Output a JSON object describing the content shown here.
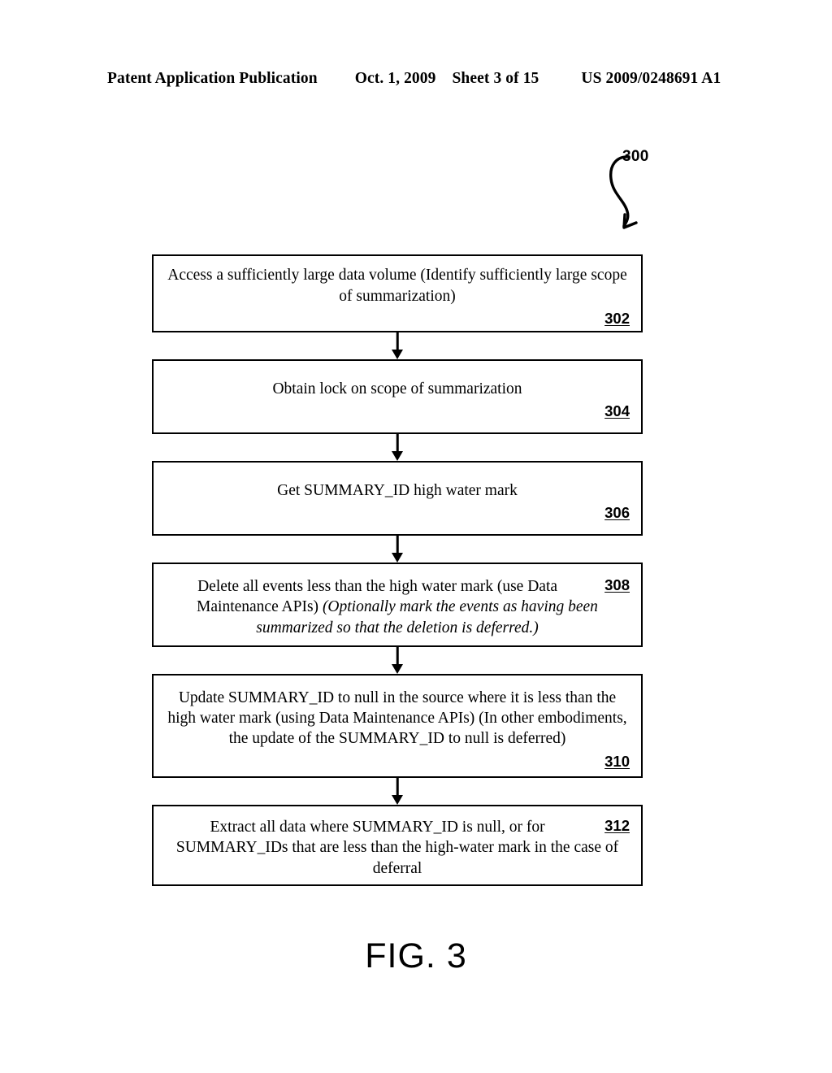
{
  "header": {
    "publication": "Patent Application Publication",
    "date": "Oct. 1, 2009",
    "sheet": "Sheet 3 of 15",
    "patent_number": "US 2009/0248691 A1"
  },
  "figure": {
    "caption": "FIG. 3",
    "lead_label": "300"
  },
  "flow": {
    "steps": [
      {
        "ref": "302",
        "text_plain": "Access a sufficiently large data volume (Identify sufficiently large scope of summarization)",
        "text_html": "Access a sufficiently large data volume (Identify sufficiently large scope of summarization)",
        "ref_placement": "below"
      },
      {
        "ref": "304",
        "text_plain": "Obtain lock on scope of summarization",
        "text_html": "Obtain lock on scope of summarization",
        "ref_placement": "below"
      },
      {
        "ref": "306",
        "text_plain": "Get SUMMARY_ID high water mark",
        "text_html": "Get SUMMARY_ID high water mark",
        "ref_placement": "below"
      },
      {
        "ref": "308",
        "text_plain": "Delete all events less than the high water mark (use Data Maintenance APIs) (Optionally mark the events as having been summarized so that the deletion is deferred.)",
        "text_html": "Delete all events less than the high water mark (use Data Maintenance APIs) <i>(Optionally mark the events as having been summarized so that the deletion is deferred.)</i>",
        "ref_placement": "inline"
      },
      {
        "ref": "310",
        "text_plain": "Update SUMMARY_ID to null in the source where it is less than the high water mark (using Data Maintenance APIs) (In other embodiments, the update of the SUMMARY_ID to null is deferred)",
        "text_html": "Update SUMMARY_ID to null in the source where it is less than the high water mark (using Data Maintenance APIs) (In other embodiments, the update of the SUMMARY_ID to null is deferred)",
        "ref_placement": "below"
      },
      {
        "ref": "312",
        "text_plain": "Extract all data where SUMMARY_ID is null, or for SUMMARY_IDs that are less than the high-water mark in the case of deferral",
        "text_html": "Extract all data where SUMMARY_ID is null, or for SUMMARY_IDs that are less than the high-water mark in the case of deferral",
        "ref_placement": "inline"
      }
    ]
  },
  "colors": {
    "ink": "#000000",
    "page": "#ffffff"
  }
}
